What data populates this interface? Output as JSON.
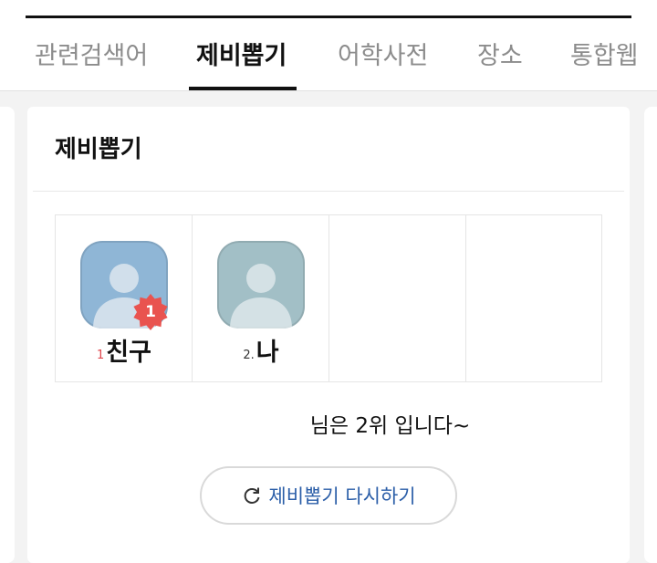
{
  "tabs": [
    {
      "label": "관련검색어",
      "active": false
    },
    {
      "label": "제비뽑기",
      "active": true
    },
    {
      "label": "어학사전",
      "active": false
    },
    {
      "label": "장소",
      "active": false
    },
    {
      "label": "통합웹",
      "active": false
    }
  ],
  "card": {
    "title": "제비뽑기",
    "participants": [
      {
        "rank": "1",
        "name": "친구",
        "avatar_color": "#8fb6d6",
        "badge": "1",
        "badge_color": "#e9534f"
      },
      {
        "rank": "2.",
        "name": "나",
        "avatar_color": "#a2bfc6"
      }
    ],
    "result_text": "님은 2위 입니다~",
    "retry_button_label": "제비뽑기 다시하기"
  },
  "colors": {
    "accent_link": "#2b5ea8",
    "badge_red": "#e9534f",
    "rank_red": "#e0454b"
  },
  "icons": {
    "avatar": "person-silhouette-icon",
    "retry": "refresh-icon"
  }
}
